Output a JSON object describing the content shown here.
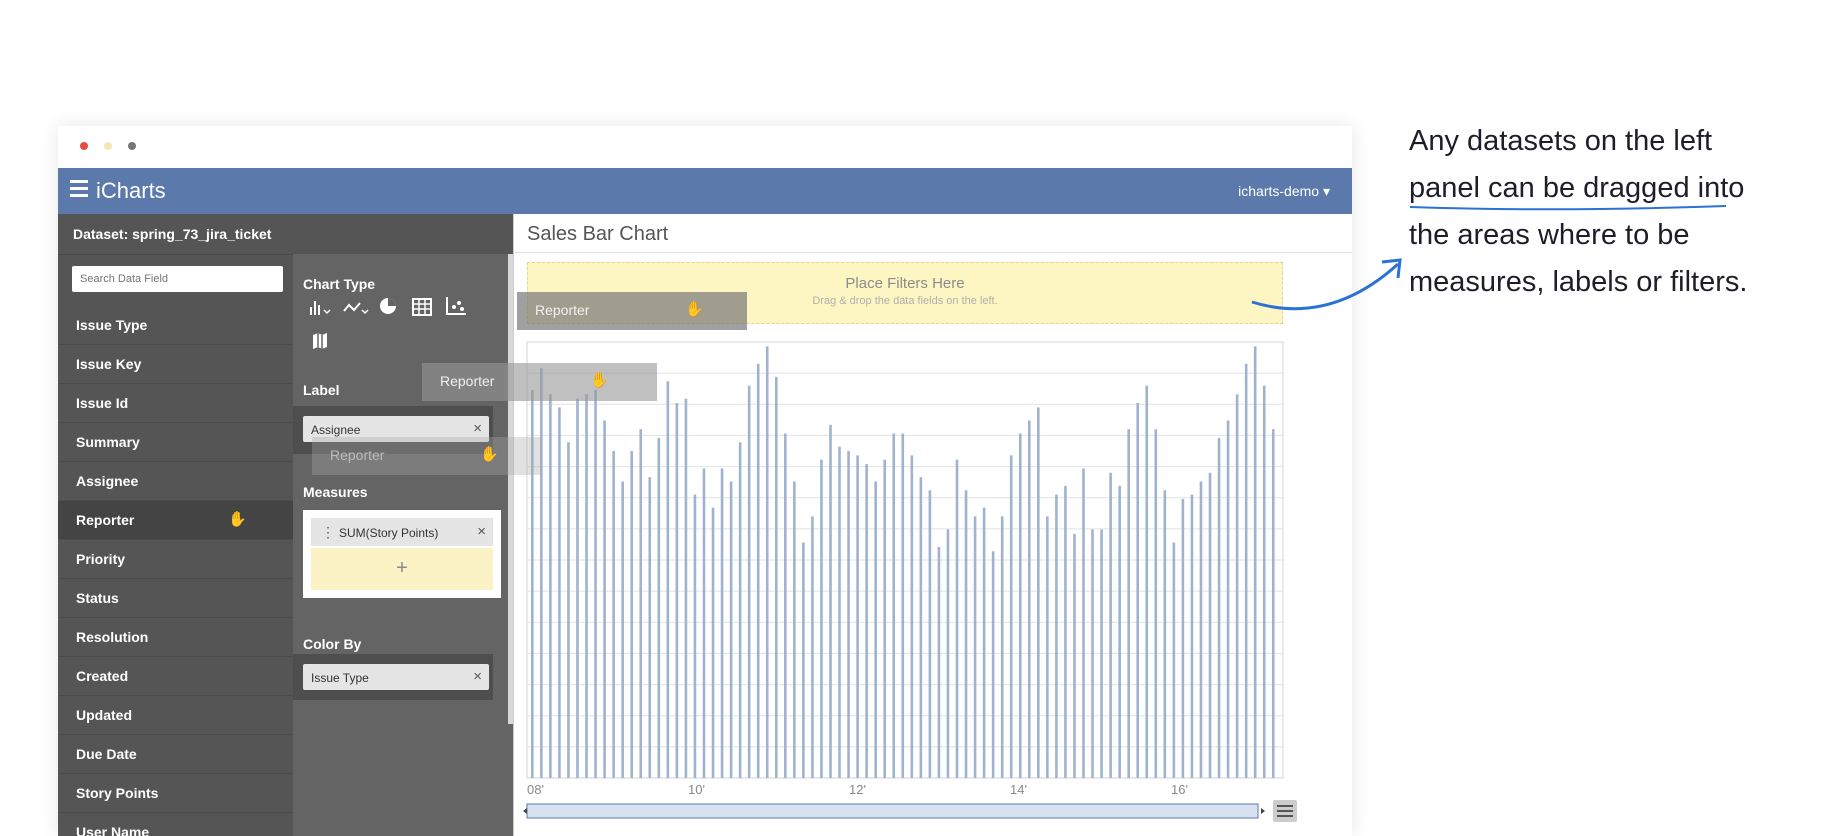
{
  "window_controls": {
    "close_color": "#e74c3c",
    "minimize_color": "#f4e7b5",
    "maximize_color": "#777777"
  },
  "app": {
    "title": "iCharts",
    "user_menu": "icharts-demo ▾",
    "accent": "#5b79aa"
  },
  "sidebar": {
    "dataset_title": "Dataset: spring_73_jira_ticket",
    "search_placeholder": "Search Data Field",
    "fields": [
      {
        "label": "Issue Type"
      },
      {
        "label": "Issue Key"
      },
      {
        "label": "Issue Id"
      },
      {
        "label": "Summary"
      },
      {
        "label": "Assignee"
      },
      {
        "label": "Reporter",
        "active": true
      },
      {
        "label": "Priority"
      },
      {
        "label": "Status"
      },
      {
        "label": "Resolution"
      },
      {
        "label": "Created"
      },
      {
        "label": "Updated"
      },
      {
        "label": "Due Date"
      },
      {
        "label": "Story Points"
      },
      {
        "label": "User Name"
      }
    ]
  },
  "config": {
    "chart_type_label": "Chart Type",
    "chart_type_icons": [
      "bar-chart-icon",
      "line-chart-icon",
      "pie-chart-icon",
      "table-icon",
      "scatter-chart-icon",
      "map-icon"
    ],
    "label_label": "Label",
    "label_pill": "Assignee",
    "measures_label": "Measures",
    "measure_pill": "SUM(Story Points)",
    "measure_add": "+",
    "color_by_label": "Color By",
    "color_by_pill": "Issue Type",
    "remove_glyph": "×"
  },
  "drag_ghosts": [
    "Reporter",
    "Reporter",
    "Reporter"
  ],
  "main": {
    "chart_title": "Sales Bar Chart",
    "filter_title": "Place Filters Here",
    "filter_subtitle": "Drag & drop the data fields on the left."
  },
  "chart_data": {
    "type": "bar",
    "title": "Sales Bar Chart",
    "x_tick_labels": [
      "08'",
      "10'",
      "12'",
      "14'",
      "16'"
    ],
    "bar_color": "#9fb3cf",
    "grid": true,
    "ylim": [
      0,
      100
    ],
    "values": [
      89,
      94,
      88,
      85,
      77,
      87,
      88,
      89,
      82,
      75,
      68,
      75,
      80,
      69,
      78,
      91,
      86,
      87,
      65,
      71,
      62,
      71,
      68,
      77,
      90,
      95,
      99,
      92,
      79,
      68,
      54,
      60,
      73,
      81,
      76,
      75,
      74,
      72,
      68,
      73,
      79,
      79,
      74,
      69,
      66,
      53,
      57,
      73,
      66,
      60,
      62,
      52,
      60,
      74,
      79,
      82,
      85,
      60,
      65,
      67,
      56,
      71,
      57,
      57,
      70,
      67,
      80,
      86,
      90,
      80,
      66,
      54,
      64,
      65,
      68,
      70,
      78,
      82,
      88,
      95,
      99,
      90,
      80
    ]
  },
  "annotation": {
    "lines": [
      "Any datasets on the left",
      "panel can be dragged into",
      "the areas where to be",
      "measures, labels or filters."
    ],
    "arrow_color": "#2a72d6"
  }
}
